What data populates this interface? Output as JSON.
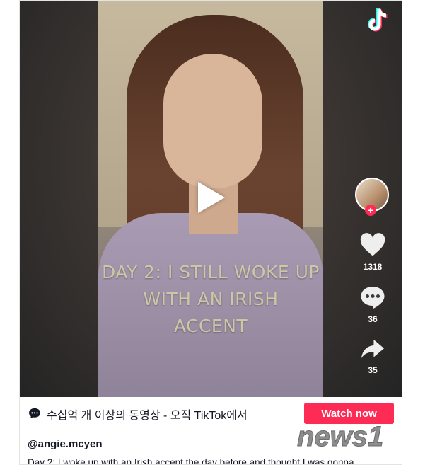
{
  "video": {
    "overlay_lines": [
      "DAY 2: I STILL WOKE UP",
      "WITH AN IRISH",
      "ACCENT"
    ],
    "likes": "1318",
    "comments": "36",
    "shares": "35"
  },
  "bar": {
    "promo_text": "수십억 개 이상의 동영상 - 오직 TikTok에서",
    "watch_button": "Watch now"
  },
  "post": {
    "handle": "@angie.mcyen",
    "caption": "Day 2: I woke up with an Irish accent the day before and thought I was gonna"
  },
  "watermark": "news1",
  "colors": {
    "accent": "#fe2c55",
    "text": "#161823",
    "overlay_text": "#cfc6a6"
  },
  "icons": [
    "tiktok-logo-icon",
    "play-icon",
    "heart-icon",
    "comment-icon",
    "share-icon",
    "chat-bubble-icon"
  ]
}
